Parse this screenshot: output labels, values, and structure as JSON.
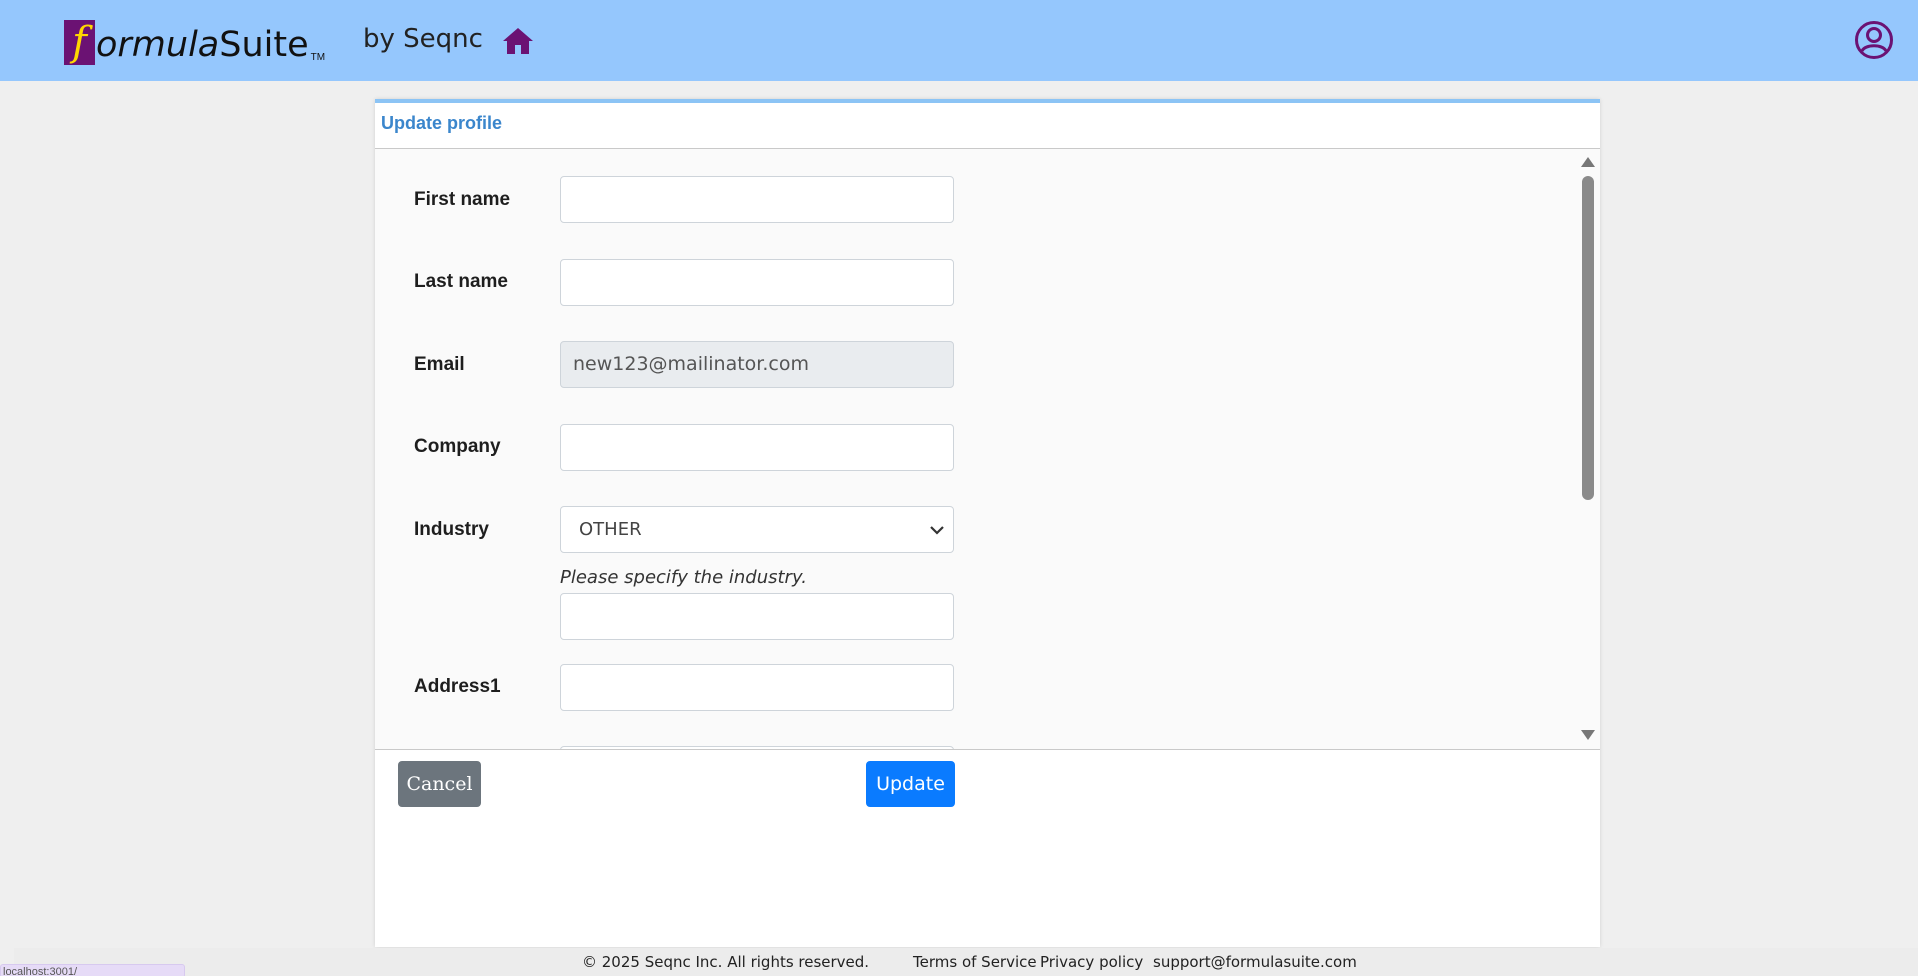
{
  "header": {
    "logo_letter": "f",
    "logo_word_italic": "ormula",
    "logo_word_regular": "Suite",
    "logo_tm": "TM",
    "byline": "by Seqnc",
    "home_icon": "home-icon",
    "user_icon": "user-circle-icon",
    "brand_color": "#6b1273",
    "bar_color": "#95c7fd"
  },
  "panel": {
    "title": "Update profile",
    "title_color": "#3b86cc"
  },
  "form": {
    "first_name_label": "First name",
    "first_name_value": "",
    "last_name_label": "Last name",
    "last_name_value": "",
    "email_label": "Email",
    "email_value": "new123@mailinator.com",
    "company_label": "Company",
    "company_value": "",
    "industry_label": "Industry",
    "industry_selected": "OTHER",
    "industry_hint": "Please specify the industry.",
    "industry_other_value": "",
    "address1_label": "Address1",
    "address1_value": ""
  },
  "actions": {
    "cancel_label": "Cancel",
    "update_label": "Update",
    "cancel_color": "#6c757d",
    "update_color": "#0a7bff"
  },
  "footer": {
    "copyright": "© 2025 Seqnc Inc. All rights reserved.",
    "terms": "Terms of Service",
    "privacy": "Privacy policy",
    "support": "support@formulasuite.com"
  },
  "corner_tab_text": "localhost:3001/"
}
